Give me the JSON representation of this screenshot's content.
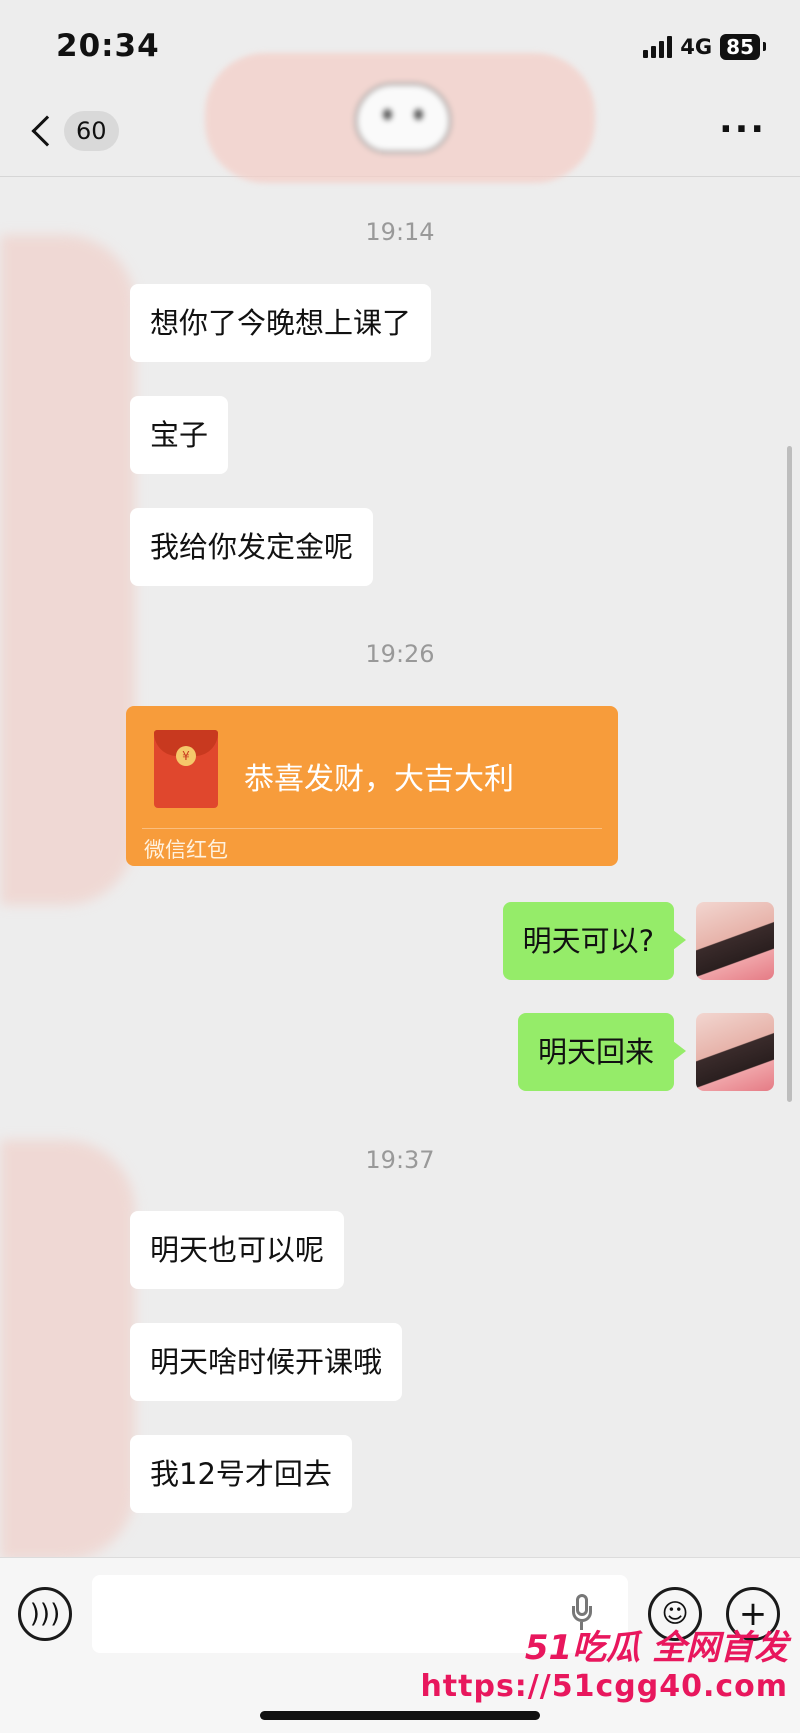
{
  "status_bar": {
    "time": "20:34",
    "network": "4G",
    "battery": "85"
  },
  "nav": {
    "unread_count": "60"
  },
  "timestamps": [
    "19:14",
    "19:26",
    "19:37"
  ],
  "messages": {
    "m1": "想你了今晚想上课了",
    "m2": "宝子",
    "m3": "我给你发定金呢",
    "m4": "明天可以?",
    "m5": "明天回来",
    "m6": "明天也可以呢",
    "m7": "明天啥时候开课哦",
    "m8": "我12号才回去"
  },
  "red_packet": {
    "title": "恭喜发财，大吉大利",
    "label": "微信红包",
    "coin": "¥"
  },
  "watermark": {
    "brand": "51吃瓜 全网首发",
    "url": "https://51cgg40.com"
  },
  "icons": [
    "back-chevron-icon",
    "more-icon",
    "voice-icon",
    "mic-icon",
    "emoji-icon",
    "plus-icon",
    "red-packet-icon"
  ],
  "colors": {
    "incoming_bubble": "#ffffff",
    "outgoing_bubble": "#95ec69",
    "red_packet": "#f79c3b",
    "watermark": "#e8175d"
  }
}
